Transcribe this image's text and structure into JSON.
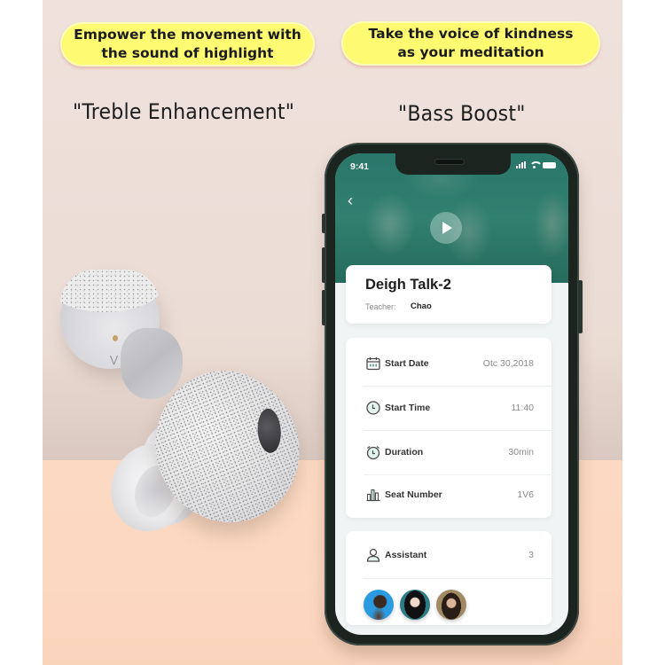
{
  "banners": {
    "left": "Empower the movement with\nthe sound of highlight",
    "right": "Take the voice of kindness\nas your meditation"
  },
  "modes": {
    "treble": "\"Treble Enhancement\"",
    "bass": "\"Bass Boost\""
  },
  "phone": {
    "status_bar": {
      "time": "9:41"
    },
    "hero": {
      "back_icon": "chevron-left-icon",
      "play_icon": "play-icon"
    },
    "course": {
      "title": "Deigh Talk-2",
      "teacher_label": "Teacher:",
      "teacher_name": "Chao"
    },
    "details": [
      {
        "icon": "calendar-icon",
        "label": "Start Date",
        "value": "Otc 30,2018"
      },
      {
        "icon": "clock-icon",
        "label": "Start Time",
        "value": "11:40"
      },
      {
        "icon": "alarm-clock-icon",
        "label": "Duration",
        "value": "30min"
      },
      {
        "icon": "bar-chart-icon",
        "label": "Seat Number",
        "value": "1V6"
      }
    ],
    "assistant": {
      "icon": "user-icon",
      "label": "Assistant",
      "count": "3",
      "avatars": [
        "avatar-1",
        "avatar-2",
        "avatar-3"
      ]
    }
  },
  "colors": {
    "banner_yellow": "#fefa72",
    "wall": "#efe2dc",
    "floor": "#fcd9c2",
    "hero_teal": "#2f7d70",
    "icon_accent": "#4fa88f"
  }
}
